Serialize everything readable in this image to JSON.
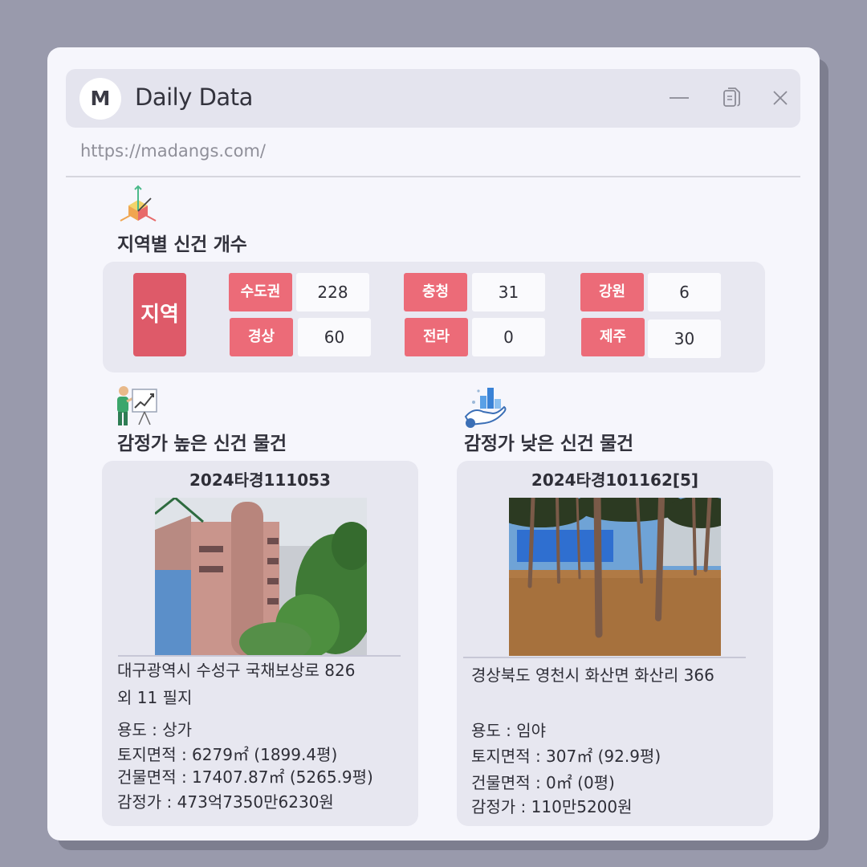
{
  "app": {
    "logo_letter": "M",
    "title": "Daily Data",
    "url": "https://madangs.com/"
  },
  "region_section": {
    "title": "지역별 신건 개수",
    "header_label": "지역",
    "regions": [
      {
        "name": "수도권",
        "count": "228"
      },
      {
        "name": "충청",
        "count": "31"
      },
      {
        "name": "강원",
        "count": "6"
      },
      {
        "name": "경상",
        "count": "60"
      },
      {
        "name": "전라",
        "count": "0"
      },
      {
        "name": "제주",
        "count": "30"
      }
    ]
  },
  "high_section": {
    "title": "감정가 높은 신건 물건",
    "case_no": "2024타경111053",
    "address_line1": "대구광역시 수성구 국채보상로 826",
    "address_line2": "외 11 필지",
    "usage": "용도 : 상가",
    "land_area": "토지면적 : 6279㎡ (1899.4평)",
    "building_area": "건물면적 : 17407.87㎡ (5265.9평)",
    "appraisal": "감정가 : 473억7350만6230원"
  },
  "low_section": {
    "title": "감정가 낮은 신건 물건",
    "case_no": "2024타경101162[5]",
    "address_line1": "경상북도 영천시 화산면 화산리 366",
    "usage": "용도 : 임야",
    "land_area": "토지면적 : 307㎡ (92.9평)",
    "building_area": "건물면적 : 0㎡ (0평)",
    "appraisal": "감정가 : 110만5200원"
  },
  "colors": {
    "background": "#999aac",
    "window": "#f6f6fc",
    "panel": "#e8e8f1",
    "label_red": "#ec6b78",
    "header_red": "#de5a69"
  },
  "icons": {
    "region": "3d-axis-icon",
    "high": "presentation-chart-icon",
    "low": "hand-bar-chart-icon",
    "minimize": "minimize-icon",
    "copy": "copy-icon",
    "close": "close-icon"
  }
}
